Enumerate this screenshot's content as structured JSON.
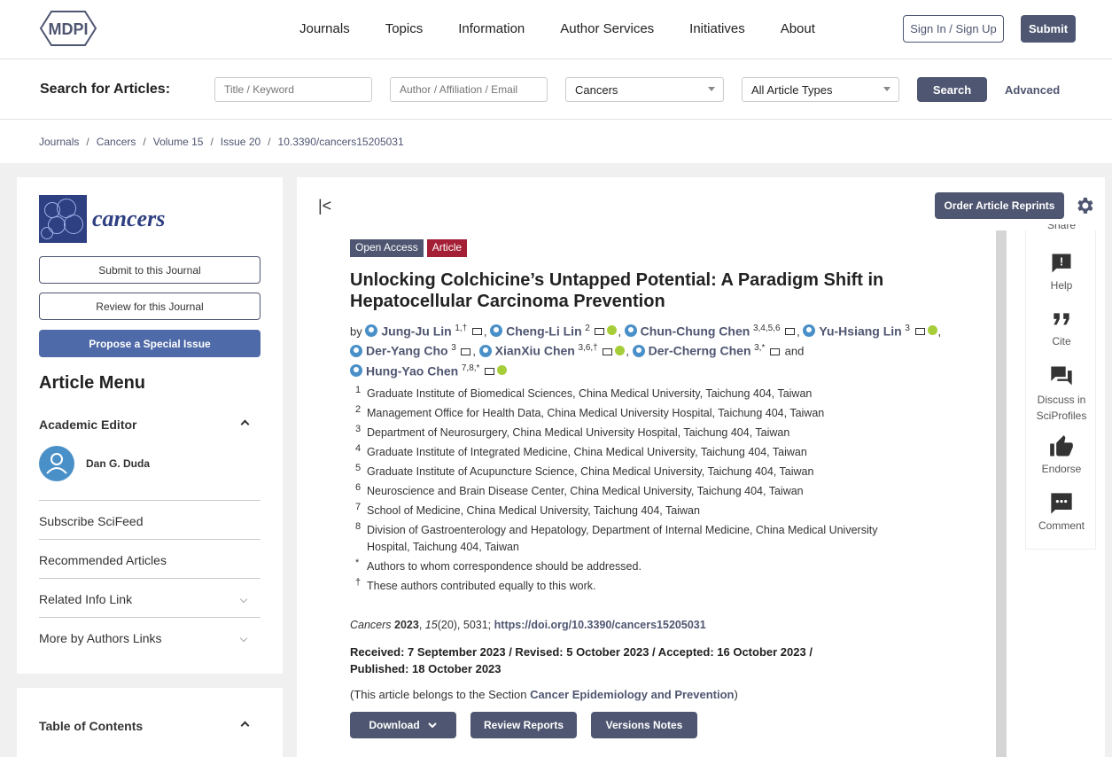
{
  "header": {
    "logo_text": "MDPI",
    "nav": [
      "Journals",
      "Topics",
      "Information",
      "Author Services",
      "Initiatives",
      "About"
    ],
    "sign_in": "Sign In / Sign Up",
    "submit": "Submit"
  },
  "search": {
    "label": "Search for Articles:",
    "title_placeholder": "Title / Keyword",
    "author_placeholder": "Author / Affiliation / Email",
    "journal_value": "Cancers",
    "type_value": "All Article Types",
    "button": "Search",
    "advanced": "Advanced"
  },
  "breadcrumb": [
    "Journals",
    "Cancers",
    "Volume 15",
    "Issue 20",
    "10.3390/cancers15205031"
  ],
  "sidebar": {
    "journal_name": "cancers",
    "submit_btn": "Submit to this Journal",
    "review_btn": "Review for this Journal",
    "propose_btn": "Propose a Special Issue",
    "menu_title": "Article Menu",
    "academic_editor": "Academic Editor",
    "editor_name": "Dan G. Duda",
    "items": [
      "Subscribe SciFeed",
      "Recommended Articles",
      "Related Info Link",
      "More by Authors Links"
    ],
    "toc": "Table of Contents"
  },
  "article": {
    "collapse": "|<",
    "order_reprints": "Order Article Reprints",
    "tag_open": "Open Access",
    "tag_article": "Article",
    "title": "Unlocking Colchicine’s Untapped Potential: A Paradigm Shift in Hepatocellular Carcinoma Prevention",
    "by": "by",
    "authors": [
      {
        "name": "Jung-Ju Lin",
        "sup": "1,†"
      },
      {
        "name": "Cheng-Li Lin",
        "sup": "2"
      },
      {
        "name": "Chun-Chung Chen",
        "sup": "3,4,5,6"
      },
      {
        "name": "Yu-Hsiang Lin",
        "sup": "3"
      },
      {
        "name": "Der-Yang Cho",
        "sup": "3"
      },
      {
        "name": "XianXiu Chen",
        "sup": "3,6,†"
      },
      {
        "name": "Der-Cherng Chen",
        "sup": "3,*"
      },
      {
        "name": "Hung-Yao Chen",
        "sup": "7,8,*"
      }
    ],
    "and": "and",
    "affiliations": [
      {
        "n": "1",
        "text": "Graduate Institute of Biomedical Sciences, China Medical University, Taichung 404, Taiwan"
      },
      {
        "n": "2",
        "text": "Management Office for Health Data, China Medical University Hospital, Taichung 404, Taiwan"
      },
      {
        "n": "3",
        "text": "Department of Neurosurgery, China Medical University Hospital, Taichung 404, Taiwan"
      },
      {
        "n": "4",
        "text": "Graduate Institute of Integrated Medicine, China Medical University, Taichung 404, Taiwan"
      },
      {
        "n": "5",
        "text": "Graduate Institute of Acupuncture Science, China Medical University, Taichung 404, Taiwan"
      },
      {
        "n": "6",
        "text": "Neuroscience and Brain Disease Center, China Medical University, Taichung 404, Taiwan"
      },
      {
        "n": "7",
        "text": "School of Medicine, China Medical University, Taichung 404, Taiwan"
      },
      {
        "n": "8",
        "text": "Division of Gastroenterology and Hepatology, Department of Internal Medicine, China Medical University Hospital, Taichung 404, Taiwan"
      },
      {
        "n": "*",
        "text": "Authors to whom correspondence should be addressed."
      },
      {
        "n": "†",
        "text": "These authors contributed equally to this work."
      }
    ],
    "citation_journal": "Cancers",
    "citation_year": "2023",
    "citation_volume": "15",
    "citation_rest": "(20), 5031;",
    "doi": "https://doi.org/10.3390/cancers15205031",
    "dates": "Received: 7 September 2023 / Revised: 5 October 2023 / Accepted: 16 October 2023 / Published: 18 October 2023",
    "section_prefix": "(This article belongs to the Section",
    "section_name": "Cancer Epidemiology and Prevention",
    "section_suffix": ")",
    "btn_download": "Download",
    "btn_review": "Review Reports",
    "btn_versions": "Versions Notes"
  },
  "right_panel": {
    "share": "Share",
    "help": "Help",
    "cite": "Cite",
    "discuss": "Discuss in SciProfiles",
    "endorse": "Endorse",
    "comment": "Comment"
  }
}
